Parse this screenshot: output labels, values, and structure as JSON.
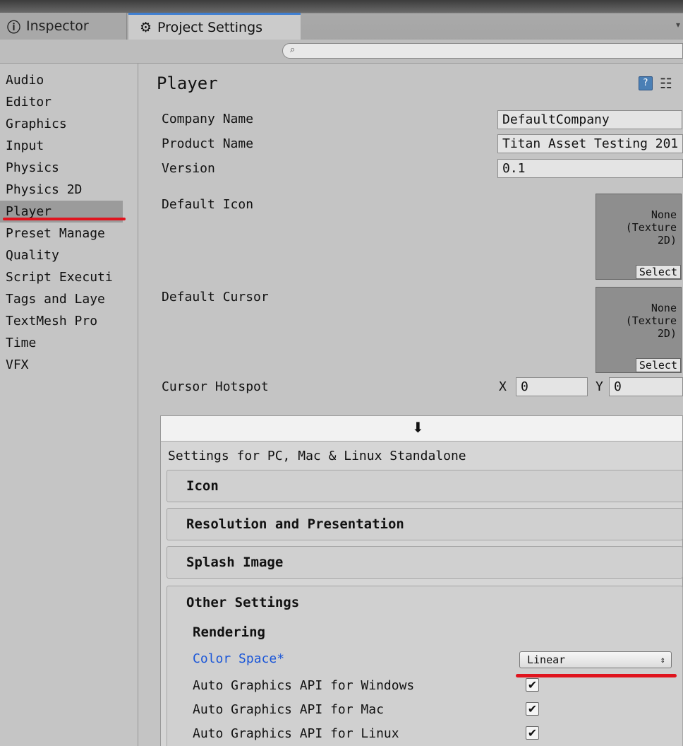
{
  "tabs": [
    {
      "label": "Inspector",
      "icon": "info-icon"
    },
    {
      "label": "Project Settings",
      "icon": "gear-icon"
    }
  ],
  "search": {
    "placeholder": ""
  },
  "sidebar": {
    "items": [
      "Audio",
      "Editor",
      "Graphics",
      "Input",
      "Physics",
      "Physics 2D",
      "Player",
      "Preset Manage",
      "Quality",
      "Script Executi",
      "Tags and Laye",
      "TextMesh Pro",
      "Time",
      "VFX"
    ],
    "selected": "Player"
  },
  "player": {
    "title": "Player",
    "company_label": "Company Name",
    "company_value": "DefaultCompany",
    "product_label": "Product Name",
    "product_value": "Titan Asset Testing 201",
    "version_label": "Version",
    "version_value": "0.1",
    "icon_label": "Default Icon",
    "icon_tex": "None\n(Texture\n2D)",
    "cursor_label": "Default Cursor",
    "cursor_tex": "None\n(Texture\n2D)",
    "select_label": "Select",
    "hotspot_label": "Cursor Hotspot",
    "hotspot_x_label": "X",
    "hotspot_x": "0",
    "hotspot_y_label": "Y",
    "hotspot_y": "0"
  },
  "platform": {
    "label": "Settings for PC, Mac & Linux Standalone",
    "sections": [
      "Icon",
      "Resolution and Presentation",
      "Splash Image"
    ],
    "other_title": "Other Settings",
    "rendering_head": "Rendering",
    "color_space_label": "Color Space*",
    "color_space_value": "Linear",
    "auto_windows": "Auto Graphics API  for Windows",
    "auto_mac": "Auto Graphics API  for Mac",
    "auto_linux": "Auto Graphics API  for Linux"
  },
  "colors": {
    "link": "#1a56d8",
    "annotation": "#e0141e",
    "tab_accent": "#3f7fd1"
  }
}
